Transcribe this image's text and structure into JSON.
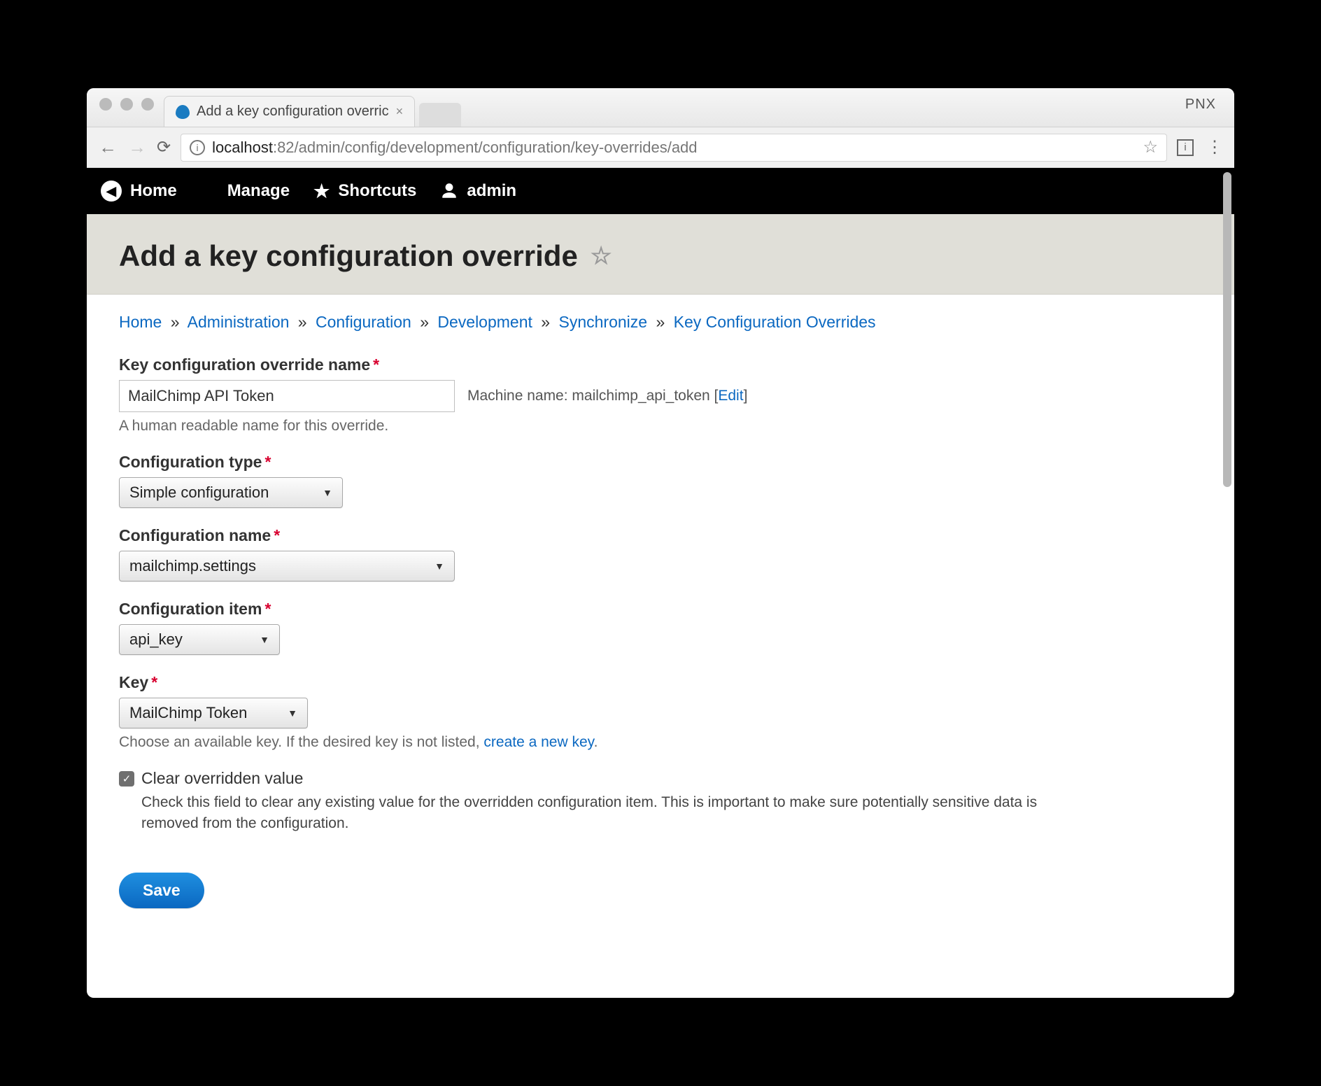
{
  "browser": {
    "tab_title": "Add a key configuration overric",
    "profile_badge": "PNX",
    "url_host": "localhost",
    "url_port_path": ":82/admin/config/development/configuration/key-overrides/add"
  },
  "toolbar": {
    "home": "Home",
    "manage": "Manage",
    "shortcuts": "Shortcuts",
    "user": "admin"
  },
  "page": {
    "title": "Add a key configuration override"
  },
  "breadcrumb": {
    "items": [
      "Home",
      "Administration",
      "Configuration",
      "Development",
      "Synchronize",
      "Key Configuration Overrides"
    ],
    "sep": "»"
  },
  "form": {
    "name": {
      "label": "Key configuration override name",
      "value": "MailChimp API Token",
      "machine_label": "Machine name:",
      "machine_value": "mailchimp_api_token",
      "edit": "Edit",
      "description": "A human readable name for this override."
    },
    "config_type": {
      "label": "Configuration type",
      "value": "Simple configuration"
    },
    "config_name": {
      "label": "Configuration name",
      "value": "mailchimp.settings"
    },
    "config_item": {
      "label": "Configuration item",
      "value": "api_key"
    },
    "key": {
      "label": "Key",
      "value": "MailChimp Token",
      "description_prefix": "Choose an available key. If the desired key is not listed, ",
      "description_link": "create a new key",
      "description_suffix": "."
    },
    "clear": {
      "label": "Clear overridden value",
      "checked": true,
      "description": "Check this field to clear any existing value for the overridden configuration item. This is important to make sure potentially sensitive data is removed from the configuration."
    },
    "save": "Save"
  }
}
